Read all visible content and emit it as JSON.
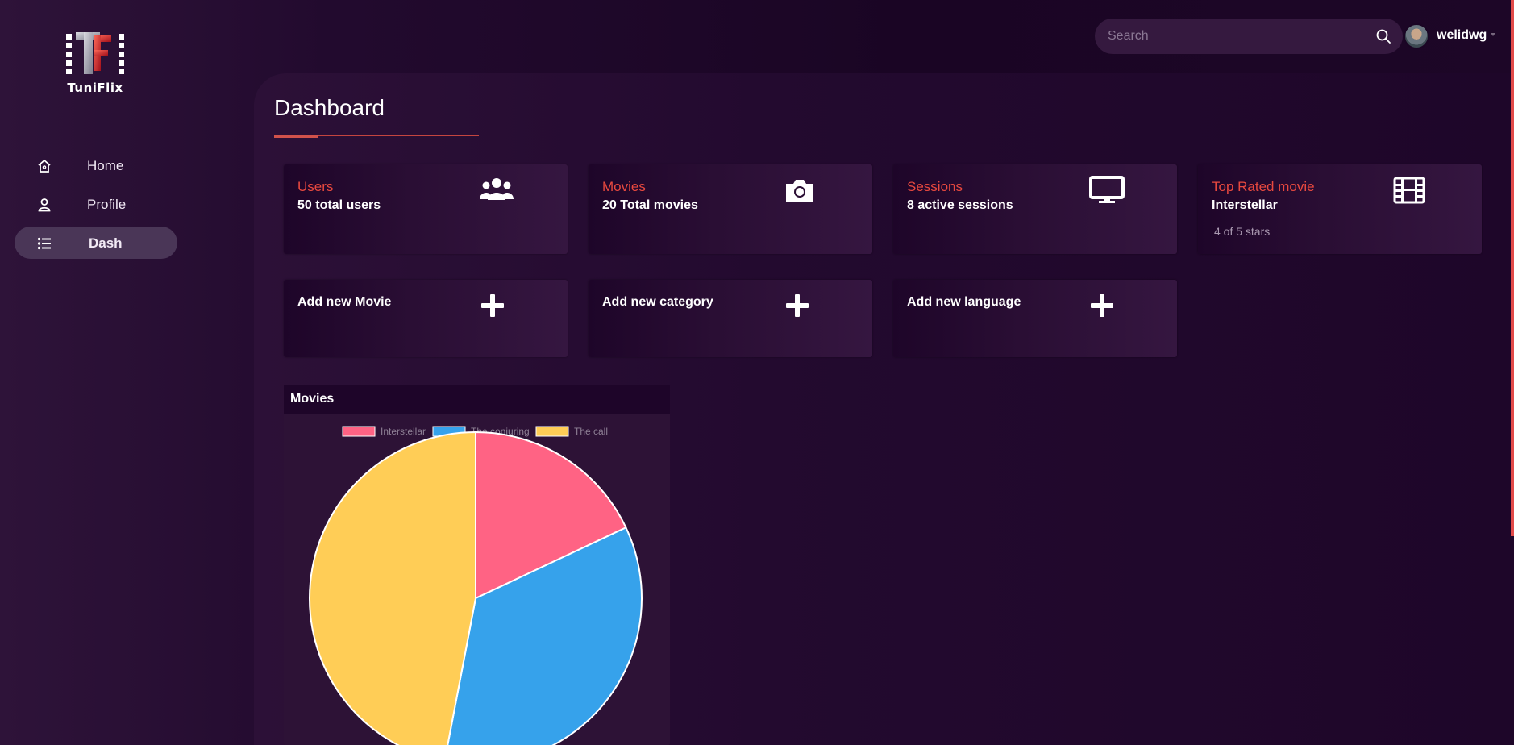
{
  "brand": {
    "name": "TuniFlix"
  },
  "sidebar": {
    "items": [
      {
        "label": "Home",
        "icon": "home-icon",
        "active": false
      },
      {
        "label": "Profile",
        "icon": "user-icon",
        "active": false
      },
      {
        "label": "Dash",
        "icon": "list-icon",
        "active": true
      }
    ]
  },
  "topbar": {
    "search_placeholder": "Search",
    "username": "welidwg"
  },
  "page": {
    "title": "Dashboard"
  },
  "stats": [
    {
      "title": "Users",
      "value": "50 total users",
      "icon": "users-icon"
    },
    {
      "title": "Movies",
      "value": "20 Total movies",
      "icon": "camera-icon"
    },
    {
      "title": "Sessions",
      "value": "8 active sessions",
      "icon": "monitor-icon"
    },
    {
      "title": "Top Rated movie",
      "value": "Interstellar",
      "sub": "4 of 5 stars",
      "icon": "film-icon"
    }
  ],
  "actions": [
    {
      "label": "Add new Movie",
      "icon": "plus-icon"
    },
    {
      "label": "Add new category",
      "icon": "plus-icon"
    },
    {
      "label": "Add new language",
      "icon": "plus-icon"
    }
  ],
  "colors": {
    "accent": "#e8493f",
    "active_nav": "#4a3657"
  },
  "chart_data": {
    "type": "pie",
    "title": "Movies",
    "categories": [
      "Interstellar",
      "The conjuring",
      "The call"
    ],
    "values": [
      18,
      35,
      47
    ],
    "colors": [
      "#ff6384",
      "#36a2eb",
      "#ffcd56"
    ],
    "legend": "top"
  }
}
